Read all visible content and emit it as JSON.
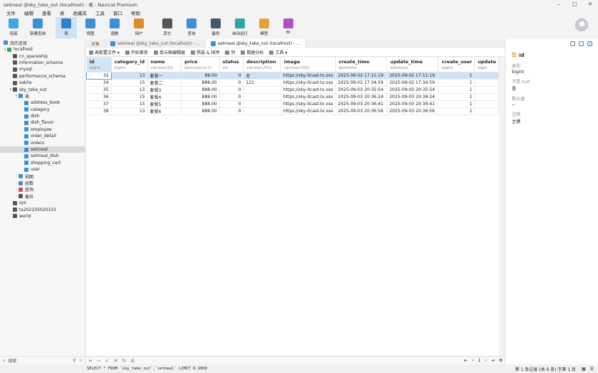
{
  "window": {
    "title": "setmeal @sky_take_out (localhost) - 表 - Navicat Premium",
    "controls": [
      "–",
      "□",
      "✕"
    ]
  },
  "menu": [
    "文件",
    "编辑",
    "查看",
    "表",
    "收藏夹",
    "工具",
    "窗口",
    "帮助"
  ],
  "toolbar": [
    {
      "label": "连接",
      "color": "#3fa8e4"
    },
    {
      "label": "新建查询",
      "color": "#3d8fd6"
    },
    {
      "label": "表",
      "color": "#2f7fd0"
    },
    {
      "label": "视图",
      "color": "#3d8fd6"
    },
    {
      "label": "函数",
      "color": "#3d8fd6"
    },
    {
      "label": "用户",
      "color": "#e08a2f"
    },
    {
      "label": "其它",
      "color": "#555555"
    },
    {
      "label": "查询",
      "color": "#3d8fd6"
    },
    {
      "label": "备份",
      "color": "#44586b"
    },
    {
      "label": "自动运行",
      "color": "#2ea7a0"
    },
    {
      "label": "模型",
      "color": "#e5a23a"
    },
    {
      "label": "BI",
      "color": "#b34fc4"
    }
  ],
  "left_panel": {
    "header": "我的连接",
    "tree": [
      {
        "label": "localhost",
        "depth": 0,
        "arrow": "∨",
        "color": "#3aa655"
      },
      {
        "label": "cn_spaceship",
        "depth": 1,
        "arrow": "",
        "color": "#555555"
      },
      {
        "label": "information_schema",
        "depth": 1,
        "arrow": "",
        "color": "#555555"
      },
      {
        "label": "mysql",
        "depth": 1,
        "arrow": "",
        "color": "#555555"
      },
      {
        "label": "performance_schema",
        "depth": 1,
        "arrow": "",
        "color": "#555555"
      },
      {
        "label": "sakila",
        "depth": 1,
        "arrow": "",
        "color": "#555555"
      },
      {
        "label": "sky_take_out",
        "depth": 1,
        "arrow": "∨",
        "color": "#555555"
      },
      {
        "label": "表",
        "depth": 2,
        "arrow": "∨",
        "color": "#3d8fd6"
      },
      {
        "label": "address_book",
        "depth": 3,
        "arrow": "",
        "color": "#3d8fd6"
      },
      {
        "label": "category",
        "depth": 3,
        "arrow": "",
        "color": "#3d8fd6"
      },
      {
        "label": "dish",
        "depth": 3,
        "arrow": "",
        "color": "#3d8fd6"
      },
      {
        "label": "dish_flavor",
        "depth": 3,
        "arrow": "",
        "color": "#3d8fd6"
      },
      {
        "label": "employee",
        "depth": 3,
        "arrow": "",
        "color": "#3d8fd6"
      },
      {
        "label": "order_detail",
        "depth": 3,
        "arrow": "",
        "color": "#3d8fd6"
      },
      {
        "label": "orders",
        "depth": 3,
        "arrow": "",
        "color": "#3d8fd6"
      },
      {
        "label": "setmeal",
        "depth": 3,
        "arrow": "",
        "color": "#3d8fd6",
        "selected": true
      },
      {
        "label": "setmeal_dish",
        "depth": 3,
        "arrow": "",
        "color": "#3d8fd6"
      },
      {
        "label": "shopping_cart",
        "depth": 3,
        "arrow": "",
        "color": "#3d8fd6"
      },
      {
        "label": "user",
        "depth": 3,
        "arrow": "",
        "color": "#3d8fd6"
      },
      {
        "label": "视图",
        "depth": 2,
        "arrow": "›",
        "color": "#3d8fd6"
      },
      {
        "label": "函数",
        "depth": 2,
        "arrow": "›",
        "color": "#3d8fd6"
      },
      {
        "label": "查询",
        "depth": 2,
        "arrow": "›",
        "color": "#d05050"
      },
      {
        "label": "备份",
        "depth": 2,
        "arrow": "›",
        "color": "#44586b"
      },
      {
        "label": "sys",
        "depth": 1,
        "arrow": "",
        "color": "#555555"
      },
      {
        "label": "tx202235020333",
        "depth": 1,
        "arrow": "",
        "color": "#555555"
      },
      {
        "label": "world",
        "depth": 1,
        "arrow": "",
        "color": "#555555"
      }
    ],
    "search_placeholder": "搜索"
  },
  "tabs": [
    {
      "label": "对象",
      "active": false,
      "icon": false
    },
    {
      "label": "setmeal @sky_take_out (localhost) - ...",
      "active": false,
      "icon": true
    },
    {
      "label": "setmeal @sky_take_out (localhost) - ...",
      "active": true,
      "icon": true
    }
  ],
  "subtoolbar": [
    "表配置文件 ▾",
    "开始事务",
    "单元格编辑器",
    "筛选 & 排序",
    "列",
    "数据分析",
    "工具 ▾"
  ],
  "grid": {
    "columns": [
      {
        "name": "id",
        "type": "bigint",
        "key": true
      },
      {
        "name": "category_id",
        "type": "bigint"
      },
      {
        "name": "name",
        "type": "varchar(32)"
      },
      {
        "name": "price",
        "type": "decimal(10,2)"
      },
      {
        "name": "status",
        "type": "int"
      },
      {
        "name": "description",
        "type": "varchar(255)"
      },
      {
        "name": "image",
        "type": "varchar(255)"
      },
      {
        "name": "create_time",
        "type": "datetime"
      },
      {
        "name": "update_time",
        "type": "datetime"
      },
      {
        "name": "create_user",
        "type": "bigint"
      },
      {
        "name": "update",
        "type": "bigin"
      }
    ],
    "rows": [
      [
        "32",
        "13",
        "套餐一",
        "88.00",
        "0",
        "无",
        "https://sky-itcast-tx.oss",
        "2025-09-02 17:11:19",
        "2025-09-02 17:11:19",
        "1",
        ""
      ],
      [
        "34",
        "15",
        "套餐二",
        "888.00",
        "0",
        "121",
        "https://sky-itcast-tx.oss",
        "2025-09-02 17:34:59",
        "2025-09-02 17:34:59",
        "1",
        ""
      ],
      [
        "35",
        "13",
        "套餐3",
        "888.00",
        "0",
        "",
        "https://sky-itcast-tx.oss",
        "2025-09-03 20:35:54",
        "2025-09-03 20:35:54",
        "1",
        ""
      ],
      [
        "36",
        "15",
        "套餐4",
        "888.00",
        "0",
        "",
        "https://sky-itcast-tx.oss",
        "2025-09-03 20:36:24",
        "2025-09-03 20:36:24",
        "1",
        ""
      ],
      [
        "37",
        "15",
        "套餐5",
        "888.00",
        "0",
        "",
        "https://sky-itcast-tx.oss",
        "2025-09-03 20:36:41",
        "2025-09-03 20:36:41",
        "1",
        ""
      ],
      [
        "38",
        "13",
        "套餐6",
        "888.00",
        "0",
        "",
        "https://sky-itcast-tx.oss",
        "2025-09-03 20:36:56",
        "2025-09-03 20:36:56",
        "1",
        ""
      ]
    ]
  },
  "right_panel": {
    "field_name": "id",
    "items": [
      {
        "label": "类型",
        "value": "bigint"
      },
      {
        "label": "不是 null",
        "value": "是"
      },
      {
        "label": "默认值",
        "value": "--"
      },
      {
        "label": "注释",
        "value": "主键"
      }
    ]
  },
  "grid_bar": {
    "left_buttons": [
      "+",
      "−",
      "✓",
      "✕",
      "↻",
      "⊘"
    ],
    "page": "1"
  },
  "status": {
    "sql": "SELECT * FROM `sky_take_out`.`setmeal` LIMIT 0,1000",
    "record": "第 1 条记录 (共 6 条) 于第 1 页"
  }
}
